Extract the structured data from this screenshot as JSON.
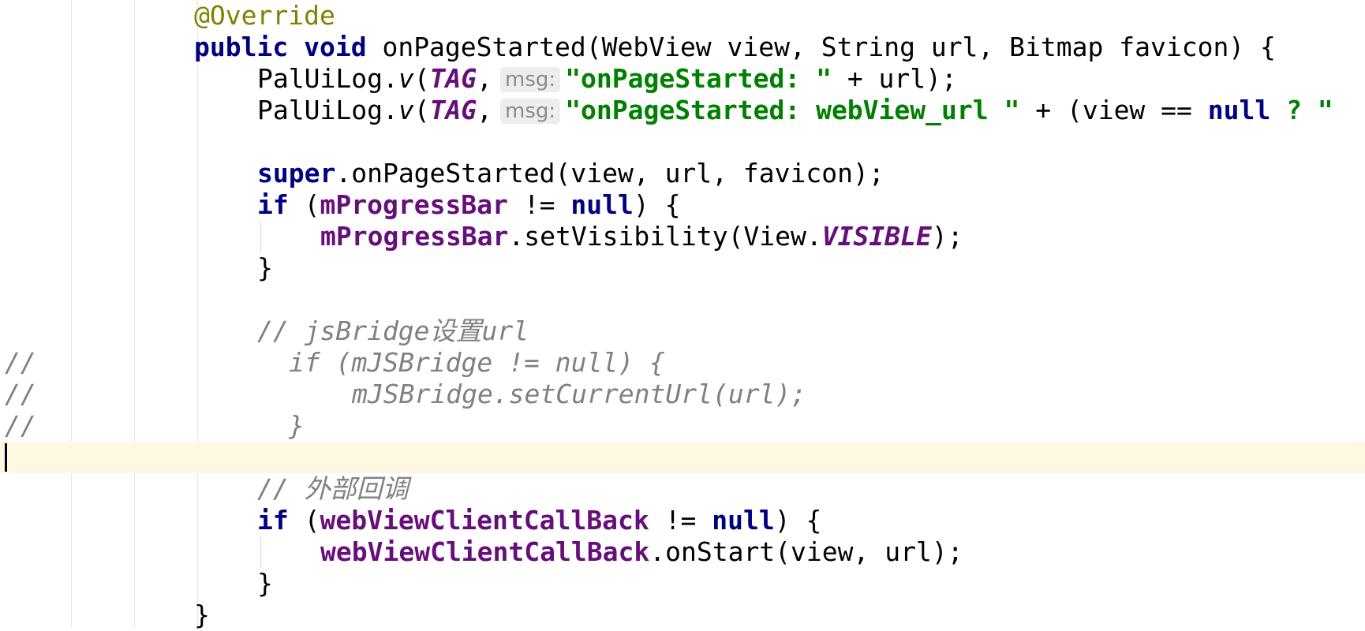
{
  "editor": {
    "lines": {
      "l1": {
        "annotation": "@Override"
      },
      "l2": {
        "kw1": "public",
        "kw2": "void",
        "rest": "onPageStarted(WebView view, String url, Bitmap favicon) {"
      },
      "l3": {
        "cls": "PalUiLog.",
        "method": "v",
        "open": "(",
        "tag": "TAG",
        "comma": ",",
        "hint": "msg:",
        "str": "\"onPageStarted: \"",
        "rest": " + url);"
      },
      "l4": {
        "cls": "PalUiLog.",
        "method": "v",
        "open": "(",
        "tag": "TAG",
        "comma": ",",
        "hint": "msg:",
        "str": "\"onPageStarted: webView_url \"",
        "rest1": " + (view == ",
        "kw": "null",
        "rest2": " ? \""
      },
      "l6": {
        "kw": "super",
        "rest": ".onPageStarted(view, url, favicon);"
      },
      "l7": {
        "kw": "if",
        "p1": " (",
        "field": "mProgressBar",
        "p2": " != ",
        "kw2": "null",
        "p3": ") {"
      },
      "l8": {
        "field": "mProgressBar",
        "mid": ".setVisibility(View.",
        "const": "VISIBLE",
        "end": ");"
      },
      "l9": {
        "text": "}"
      },
      "l11": {
        "comment": "// jsBridge设置url"
      },
      "l12": {
        "prefix": "//",
        "code": "if (mJSBridge != null) {"
      },
      "l13": {
        "prefix": "//",
        "code": "mJSBridge.setCurrentUrl(url);"
      },
      "l14": {
        "prefix": "//",
        "code": "}"
      },
      "l16": {
        "comment": "// 外部回调"
      },
      "l17": {
        "kw": "if",
        "p1": " (",
        "field": "webViewClientCallBack",
        "p2": " != ",
        "kw2": "null",
        "p3": ") {"
      },
      "l18": {
        "field": "webViewClientCallBack",
        "rest": ".onStart(view, url);"
      },
      "l19": {
        "text": "}"
      },
      "l20": {
        "text": "}"
      }
    }
  }
}
